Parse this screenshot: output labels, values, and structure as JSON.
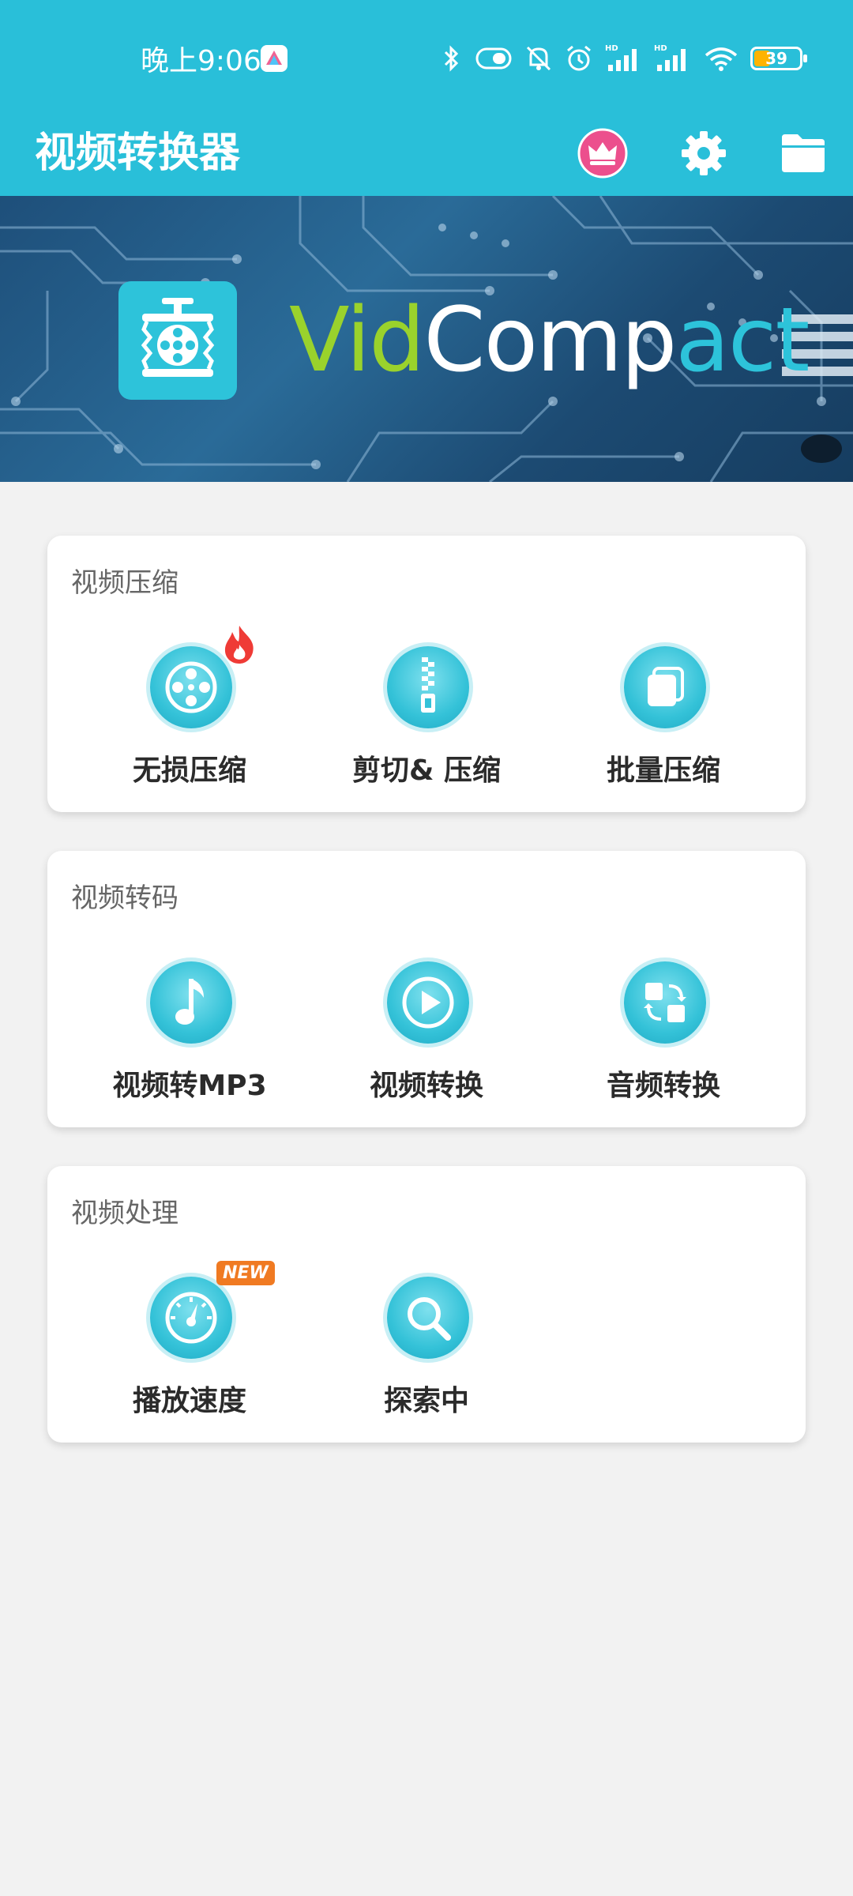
{
  "status_bar": {
    "time": "晚上9:06",
    "battery": "39",
    "icons": [
      "bluetooth-icon",
      "vibrate-icon",
      "mute-icon",
      "alarm-icon",
      "signal-hd-1-icon",
      "signal-hd-2-icon",
      "wifi-icon",
      "battery-icon"
    ]
  },
  "app_bar": {
    "title": "视频转换器",
    "actions": [
      "vip-crown-icon",
      "settings-gear-icon",
      "folder-icon"
    ],
    "background": "#29bfd9"
  },
  "banner": {
    "brand_part1": "Vid",
    "brand_part2": "Comp",
    "brand_part3": "act",
    "colors": {
      "vid": "#9ad22c",
      "comp": "#ffffff",
      "act": "#2dc3da"
    }
  },
  "sections": [
    {
      "title": "视频压缩",
      "tools": [
        {
          "label": "无损压缩",
          "icon": "film-reel-icon",
          "badge": "fire"
        },
        {
          "label": "剪切& 压缩",
          "icon": "zipper-icon"
        },
        {
          "label": "批量压缩",
          "icon": "stacked-files-icon"
        }
      ]
    },
    {
      "title": "视频转码",
      "tools": [
        {
          "label": "视频转MP3",
          "icon": "music-note-icon"
        },
        {
          "label": "视频转换",
          "icon": "play-icon"
        },
        {
          "label": "音频转换",
          "icon": "convert-arrows-icon"
        }
      ]
    },
    {
      "title": "视频处理",
      "tools": [
        {
          "label": "播放速度",
          "icon": "speedometer-icon",
          "badge": "NEW"
        },
        {
          "label": "探索中",
          "icon": "magnifier-icon"
        }
      ]
    }
  ]
}
